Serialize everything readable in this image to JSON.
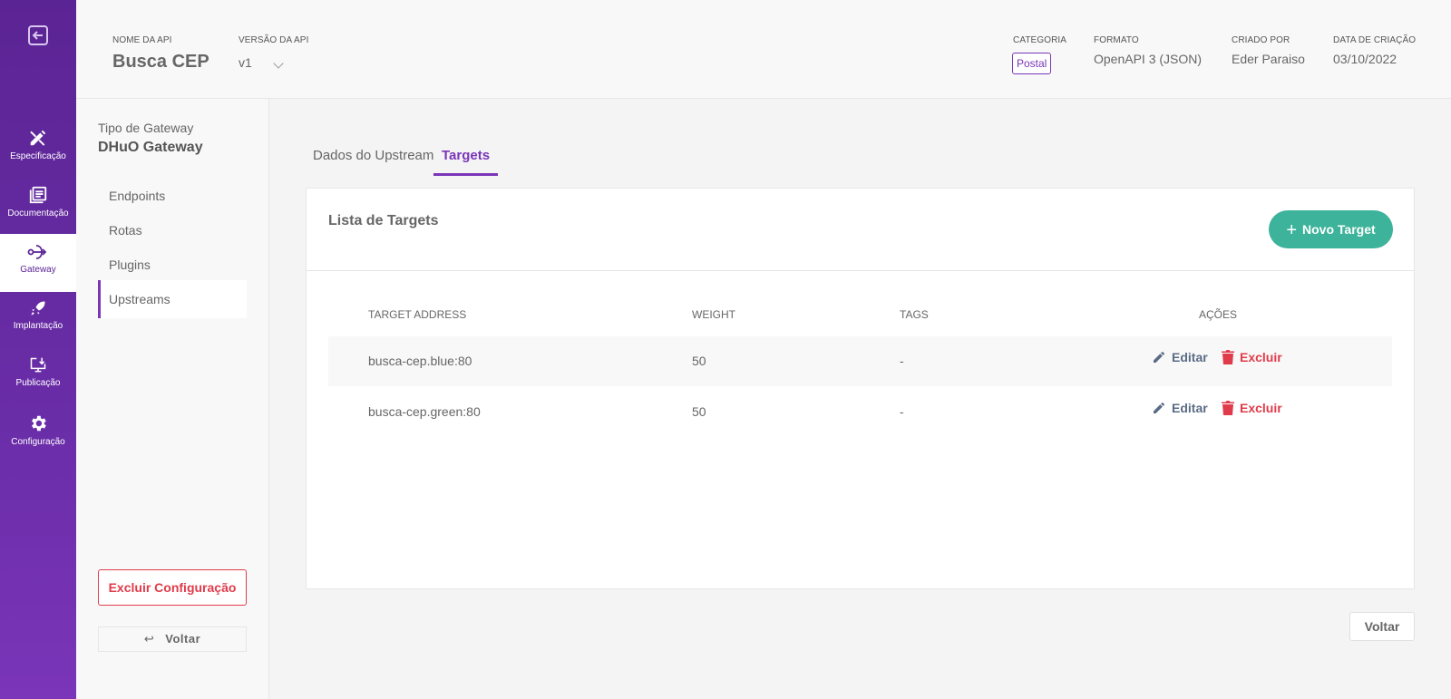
{
  "sidebar": {
    "items": [
      {
        "label": "Especificação",
        "icon": "ruler-pencil-icon"
      },
      {
        "label": "Documentação",
        "icon": "book-icon"
      },
      {
        "label": "Gateway",
        "icon": "gateway-icon"
      },
      {
        "label": "Implantação",
        "icon": "rocket-icon"
      },
      {
        "label": "Publicação",
        "icon": "monitor-download-icon"
      },
      {
        "label": "Configuração",
        "icon": "gear-icon"
      }
    ],
    "active": "Gateway"
  },
  "header": {
    "api_name_label": "NOME DA API",
    "api_name": "Busca CEP",
    "version_label": "VERSÃO DA API",
    "version": "v1",
    "category_label": "CATEGORIA",
    "category": "Postal",
    "format_label": "FORMATO",
    "format": "OpenAPI 3 (JSON)",
    "created_by_label": "CRIADO POR",
    "created_by": "Eder Paraiso",
    "created_at_label": "DATA DE CRIAÇÃO",
    "created_at": "03/10/2022"
  },
  "panel": {
    "gateway_type_label": "Tipo de Gateway",
    "gateway_type": "DHuO Gateway",
    "menu": [
      "Endpoints",
      "Rotas",
      "Plugins",
      "Upstreams"
    ],
    "active": "Upstreams",
    "delete_config": "Excluir Configuração",
    "back": "Voltar",
    "back_arrow": "↩"
  },
  "tabs": [
    "Dados do Upstream",
    "Targets"
  ],
  "active_tab": "Targets",
  "targets": {
    "title": "Lista de Targets",
    "new_button": "Novo Target",
    "columns": [
      "TARGET ADDRESS",
      "WEIGHT",
      "TAGS",
      "AÇÕES"
    ],
    "rows": [
      {
        "address": "busca-cep.blue:80",
        "weight": "50",
        "tags": "-"
      },
      {
        "address": "busca-cep.green:80",
        "weight": "50",
        "tags": "-"
      }
    ],
    "edit_label": "Editar",
    "delete_label": "Excluir"
  },
  "footer": {
    "back": "Voltar"
  },
  "colors": {
    "brand_purple": "#6a2da8",
    "accent_green": "#3cb39a",
    "danger_red": "#e03b4a"
  }
}
